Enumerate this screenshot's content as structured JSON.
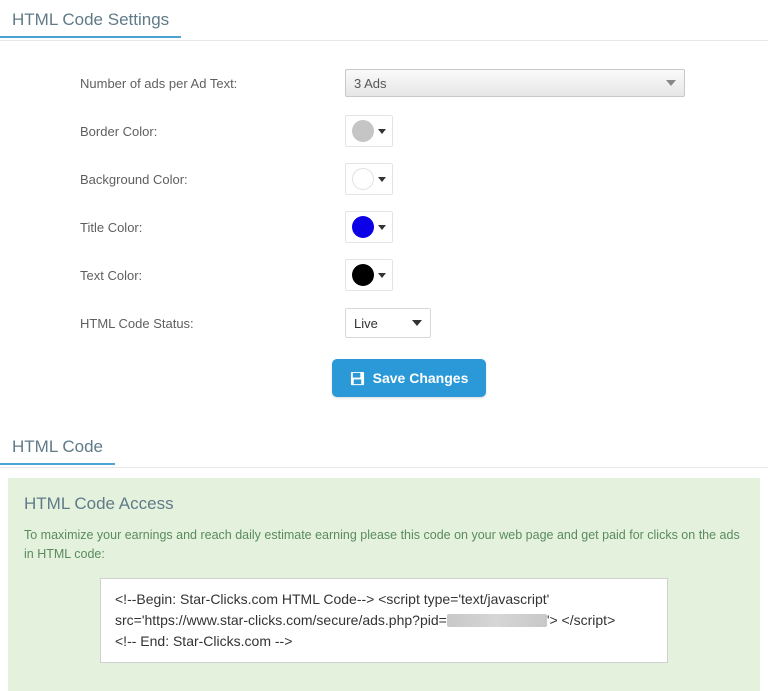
{
  "settings": {
    "title": "HTML Code Settings",
    "fields": {
      "ads_count": {
        "label": "Number of ads per Ad Text:",
        "value": "3 Ads"
      },
      "border_color": {
        "label": "Border Color:",
        "value": "#c5c5c5"
      },
      "background_color": {
        "label": "Background Color:",
        "value": "#ffffff"
      },
      "title_color": {
        "label": "Title Color:",
        "value": "#0c00e6"
      },
      "text_color": {
        "label": "Text Color:",
        "value": "#000000"
      },
      "status": {
        "label": "HTML Code Status:",
        "value": "Live"
      }
    },
    "save_label": "Save Changes"
  },
  "code_section": {
    "title": "HTML Code",
    "access_title": "HTML Code Access",
    "description": "To maximize your earnings and reach daily estimate earning please this code on your web page and get paid for clicks on the ads in HTML code:",
    "snippet_line1": "<!--Begin: Star-Clicks.com HTML Code--> <script type='text/javascript'",
    "snippet_line2_prefix": "src='https://www.star-clicks.com/secure/ads.php?pid=",
    "snippet_line2_suffix": "'> </script>",
    "snippet_line3": "<!-- End: Star-Clicks.com -->"
  }
}
